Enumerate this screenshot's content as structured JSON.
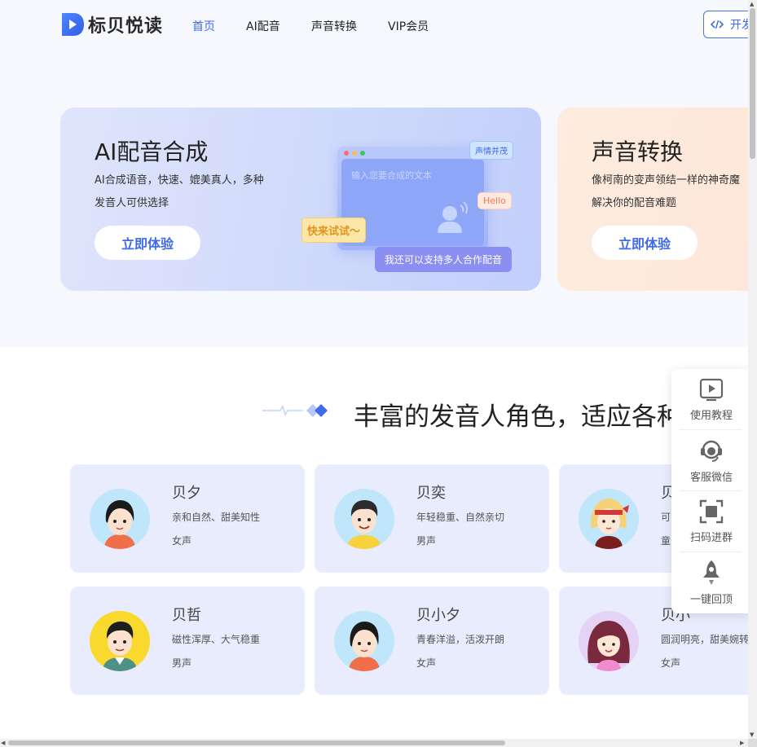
{
  "brand": {
    "name": "标贝悦读",
    "accent": "#3f6ae8"
  },
  "nav": {
    "items": [
      "首页",
      "AI配音",
      "声音转换",
      "VIP会员"
    ],
    "active": "首页"
  },
  "dev_button": {
    "label": "开发",
    "icon": "code-icon"
  },
  "feature_cards": [
    {
      "title": "AI配音合成",
      "desc_lines": [
        "AI合成语音，快速、媲美真人，多种",
        "发音人可供选择"
      ],
      "button": "立即体验",
      "illustration": {
        "placeholder": "输入您要合成的文本",
        "tags": {
          "emotion": "声情并茂",
          "hello": "Hello",
          "try": "快来试试～",
          "multi": "我还可以支持多人合作配音"
        }
      }
    },
    {
      "title": "声音转换",
      "desc_lines": [
        "像柯南的变声领结一样的神奇魔",
        "解决你的配音难题"
      ],
      "button": "立即体验"
    }
  ],
  "section": {
    "title": "丰富的发音人角色，适应各种"
  },
  "speakers": [
    {
      "name": "贝夕",
      "desc": "亲和自然、甜美知性",
      "gender": "女声"
    },
    {
      "name": "贝奕",
      "desc": "年轻稳重、自然亲切",
      "gender": "男声"
    },
    {
      "name": "贝",
      "desc": "可",
      "gender": "童"
    },
    {
      "name": "贝哲",
      "desc": "磁性浑厚、大气稳重",
      "gender": "男声"
    },
    {
      "name": "贝小夕",
      "desc": "青春洋溢，活泼开朗",
      "gender": "女声"
    },
    {
      "name": "贝小",
      "desc": "圆润明亮，甜美婉转",
      "gender": "女声"
    }
  ],
  "side_panel": [
    {
      "label": "使用教程",
      "icon": "play-icon"
    },
    {
      "label": "客服微信",
      "icon": "headset-icon"
    },
    {
      "label": "扫码进群",
      "icon": "scan-icon"
    },
    {
      "label": "一键回顶",
      "icon": "rocket-icon"
    }
  ]
}
